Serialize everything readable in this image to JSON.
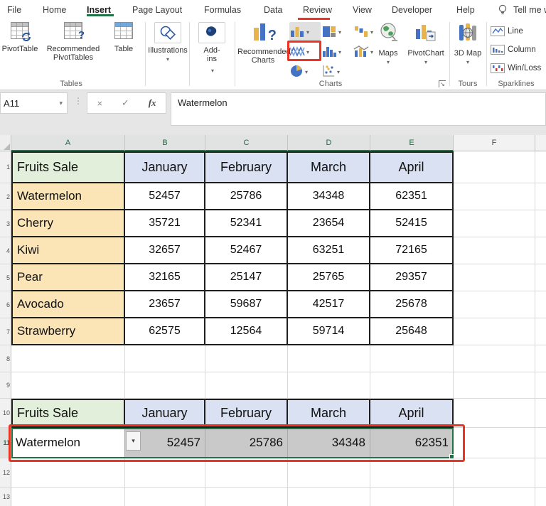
{
  "colors": {
    "excel_green": "#217346",
    "annotation_red": "#ea3523",
    "header_green_fill": "#e2efda",
    "header_blue_fill": "#d9e1f2",
    "fruit_yellow_fill": "#fbe5b6",
    "selection_gray": "#c9c9c9",
    "chart_bar_blue": "#4472c4",
    "chart_bar_gold": "#e6b34c"
  },
  "tab_bar": {
    "tabs": [
      {
        "label": "File"
      },
      {
        "label": "Home"
      },
      {
        "label": "Insert",
        "active": true
      },
      {
        "label": "Page Layout"
      },
      {
        "label": "Formulas"
      },
      {
        "label": "Data"
      },
      {
        "label": "Review"
      },
      {
        "label": "View"
      },
      {
        "label": "Developer"
      },
      {
        "label": "Help"
      }
    ],
    "tell_me": "Tell me w"
  },
  "ribbon": {
    "tables": {
      "group_label": "Tables",
      "pivottable": "PivotTable",
      "recommended_pivottables": "Recommended PivotTables",
      "table": "Table"
    },
    "illustrations": {
      "label": "Illustrations"
    },
    "addins": {
      "label": "Add-ins"
    },
    "charts": {
      "group_label": "Charts",
      "recommended_charts": "Recommended Charts",
      "maps": "Maps",
      "pivotchart": "PivotChart"
    },
    "tours": {
      "group_label": "Tours",
      "map_3d": "3D Map"
    },
    "sparklines": {
      "group_label": "Sparklines",
      "items": [
        {
          "label": "Line"
        },
        {
          "label": "Column"
        },
        {
          "label": "Win/Loss"
        }
      ]
    }
  },
  "formula_bar": {
    "name_box": "A11",
    "formula": "Watermelon"
  },
  "icons": {
    "dropdown": "▾",
    "dots": "⋮",
    "cancel": "×",
    "enter": "✓",
    "insert_function": "fx",
    "launcher_arrow": "↘"
  },
  "sheet": {
    "col_headers": [
      "A",
      "B",
      "C",
      "D",
      "E",
      "F"
    ],
    "row_numbers": [
      "1",
      "2",
      "3",
      "4",
      "5",
      "6",
      "7",
      "8",
      "9",
      "10",
      "11",
      "12",
      "13"
    ],
    "table1": {
      "header": [
        "Fruits Sale",
        "January",
        "February",
        "March",
        "April"
      ],
      "rows": [
        [
          "Watermelon",
          "52457",
          "25786",
          "34348",
          "62351"
        ],
        [
          "Cherry",
          "35721",
          "52341",
          "23654",
          "52415"
        ],
        [
          "Kiwi",
          "32657",
          "52467",
          "63251",
          "72165"
        ],
        [
          "Pear",
          "32165",
          "25147",
          "25765",
          "29357"
        ],
        [
          "Avocado",
          "23657",
          "59687",
          "42517",
          "25678"
        ],
        [
          "Strawberry",
          "62575",
          "12564",
          "59714",
          "25648"
        ]
      ]
    },
    "table2": {
      "header": [
        "Fruits Sale",
        "January",
        "February",
        "March",
        "April"
      ],
      "row": [
        "Watermelon",
        "52457",
        "25786",
        "34348",
        "62351"
      ]
    }
  }
}
